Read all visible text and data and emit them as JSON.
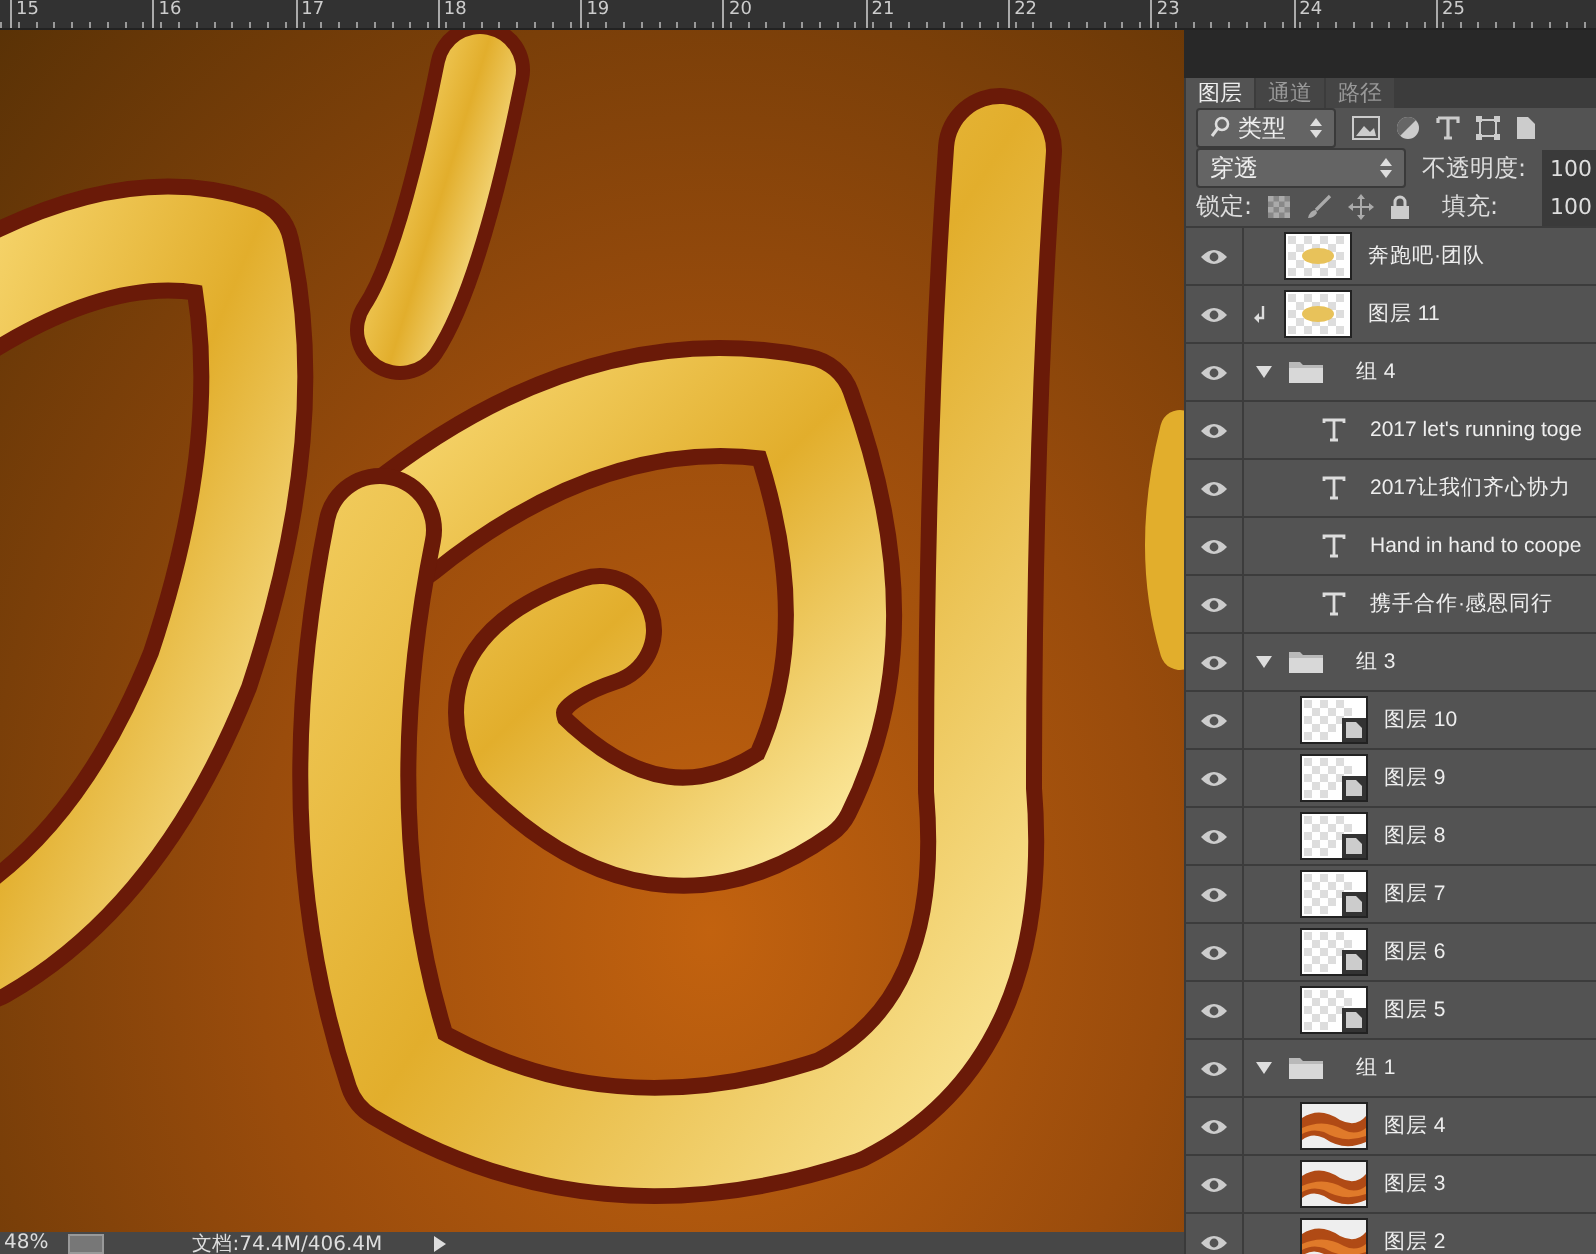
{
  "ruler": {
    "labels": [
      "15",
      "16",
      "17",
      "18",
      "19",
      "20",
      "21",
      "22",
      "23",
      "24",
      "25"
    ]
  },
  "layers_panel": {
    "tabs": [
      {
        "label": "图层",
        "selected": true
      },
      {
        "label": "通道",
        "selected": false
      },
      {
        "label": "路径",
        "selected": false
      }
    ],
    "filter": {
      "value": "类型"
    },
    "blend": {
      "value": "穿透",
      "opacity_label": "不透明度:",
      "opacity_value": "100"
    },
    "lock": {
      "label": "锁定:",
      "fill_label": "填充:",
      "fill_value": "100"
    },
    "layers": [
      {
        "name": "奔跑吧·团队",
        "kind": "pixel",
        "visible": true,
        "clipped": false
      },
      {
        "name": "图层 11",
        "kind": "pixel",
        "visible": true,
        "clipped": true
      },
      {
        "name": "组 4",
        "kind": "group",
        "visible": true,
        "expanded": true,
        "children": [
          {
            "name": "2017 let's running toge",
            "kind": "text",
            "visible": true
          },
          {
            "name": "2017让我们齐心协力",
            "kind": "text",
            "visible": true
          },
          {
            "name": "Hand in hand to coope",
            "kind": "text",
            "visible": true
          },
          {
            "name": "携手合作·感恩同行",
            "kind": "text",
            "visible": true
          }
        ]
      },
      {
        "name": "组 3",
        "kind": "group",
        "visible": true,
        "expanded": true,
        "children": [
          {
            "name": "图层 10",
            "kind": "smart",
            "visible": true
          },
          {
            "name": "图层 9",
            "kind": "smart",
            "visible": true
          },
          {
            "name": "图层 8",
            "kind": "smart",
            "visible": true
          },
          {
            "name": "图层 7",
            "kind": "smart",
            "visible": true
          },
          {
            "name": "图层 6",
            "kind": "smart",
            "visible": true
          },
          {
            "name": "图层 5",
            "kind": "smart",
            "visible": true
          }
        ]
      },
      {
        "name": "组 1",
        "kind": "group",
        "visible": true,
        "expanded": true,
        "children": [
          {
            "name": "图层 4",
            "kind": "texture",
            "visible": true
          },
          {
            "name": "图层 3",
            "kind": "texture",
            "visible": true
          },
          {
            "name": "图层 2",
            "kind": "texture",
            "visible": true
          }
        ]
      }
    ]
  },
  "status_bar": {
    "zoom": "48%",
    "doc": "文档:74.4M/406.4M"
  }
}
